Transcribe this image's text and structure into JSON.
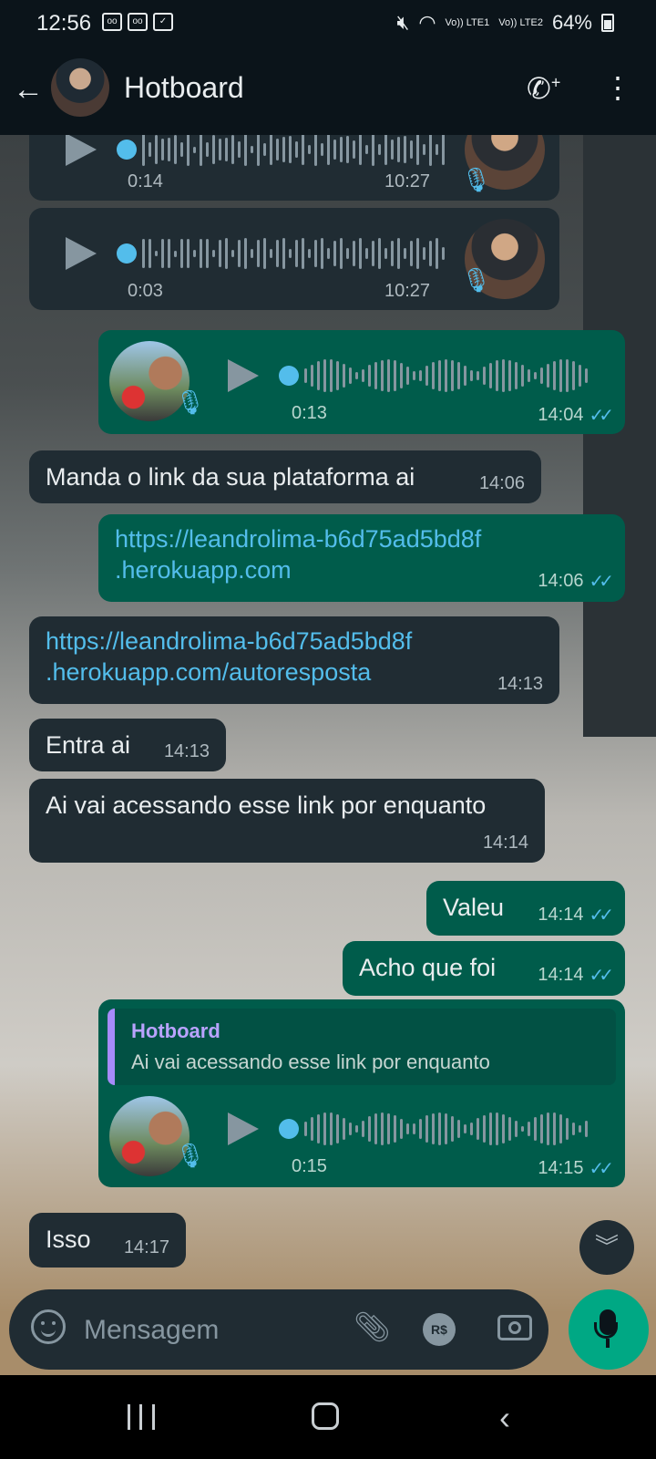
{
  "status_bar": {
    "time": "12:56",
    "battery": "64%",
    "network1": "Vo)) LTE1",
    "network2": "Vo)) LTE2"
  },
  "header": {
    "title": "Hotboard"
  },
  "messages": [
    {
      "type": "voice",
      "direction": "in",
      "duration": "0:14",
      "time": "10:27"
    },
    {
      "type": "voice",
      "direction": "in",
      "duration": "0:03",
      "time": "10:27"
    },
    {
      "type": "voice",
      "direction": "out",
      "duration": "0:13",
      "time": "14:04",
      "status": "read"
    },
    {
      "type": "text",
      "direction": "in",
      "text": "Manda o link da sua plataforma ai",
      "time": "14:06"
    },
    {
      "type": "link",
      "direction": "out",
      "text_line1": "https://leandrolima-b6d75ad5bd8f",
      "text_line2": ".herokuapp.com",
      "time": "14:06",
      "status": "read"
    },
    {
      "type": "link",
      "direction": "in",
      "text_line1": "https://leandrolima-b6d75ad5bd8f",
      "text_line2": ".herokuapp.com/autoresposta",
      "time": "14:13"
    },
    {
      "type": "text",
      "direction": "in",
      "text": "Entra ai",
      "time": "14:13"
    },
    {
      "type": "text",
      "direction": "in",
      "text": "Ai vai acessando esse link por enquanto",
      "time": "14:14"
    },
    {
      "type": "text",
      "direction": "out",
      "text": "Valeu",
      "time": "14:14",
      "status": "read"
    },
    {
      "type": "text",
      "direction": "out",
      "text": "Acho que foi",
      "time": "14:14",
      "status": "read"
    },
    {
      "type": "voice-reply",
      "direction": "out",
      "quote_name": "Hotboard",
      "quote_text": "Ai vai acessando esse link por enquanto",
      "duration": "0:15",
      "time": "14:15",
      "status": "read"
    },
    {
      "type": "text",
      "direction": "in",
      "text": "Isso",
      "time": "14:17"
    }
  ],
  "composer": {
    "placeholder": "Mensagem",
    "pay_label": "R$"
  },
  "icons": {
    "back": "arrow-left-icon",
    "call": "add-call-icon",
    "more": "more-vertical-icon",
    "emoji": "emoji-icon",
    "attach": "paperclip-icon",
    "camera": "camera-icon",
    "mic": "mic-icon"
  },
  "colors": {
    "incoming": "#202c33",
    "outgoing": "#005c4b",
    "accent": "#00a884",
    "link": "#53bdeb"
  }
}
